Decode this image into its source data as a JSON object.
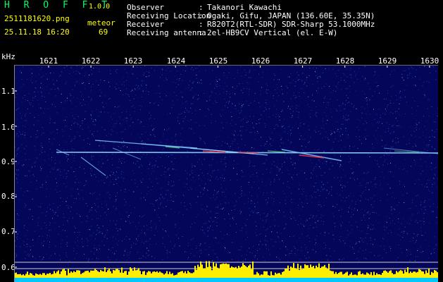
{
  "app": {
    "name": "H R O F F T",
    "version": "1.0.0"
  },
  "file": {
    "name": "2511181620.png",
    "datetime": "25.11.18 16:20"
  },
  "event": {
    "label": "meteor",
    "count": "69"
  },
  "info": [
    {
      "label": "Observer",
      "value": "Takanori Kawachi"
    },
    {
      "label": "Receiving Location",
      "value": "Ogaki, Gifu, JAPAN (136.60E, 35.35N)"
    },
    {
      "label": "Receiver",
      "value": "R820T2(RTL-SDR) SDR-Sharp 53.1000MHz"
    },
    {
      "label": "Receiving antenna",
      "value": "2el-HB9CV Vertical (el. E-W)"
    }
  ],
  "axis": {
    "unit": "kHz",
    "x_ticks": [
      "1621",
      "1622",
      "1623",
      "1624",
      "1625",
      "1626",
      "1627",
      "1628",
      "1629",
      "1630"
    ],
    "y_ticks": [
      "1.1",
      "1.0",
      "0.9",
      "0.8",
      "0.7",
      "0.6"
    ]
  },
  "colors": {
    "background": "#04065a",
    "carrier": "#8fd8ff",
    "trail": "#7ec8ff",
    "hot": "#ff3344",
    "histogram": "#ffee00"
  }
}
